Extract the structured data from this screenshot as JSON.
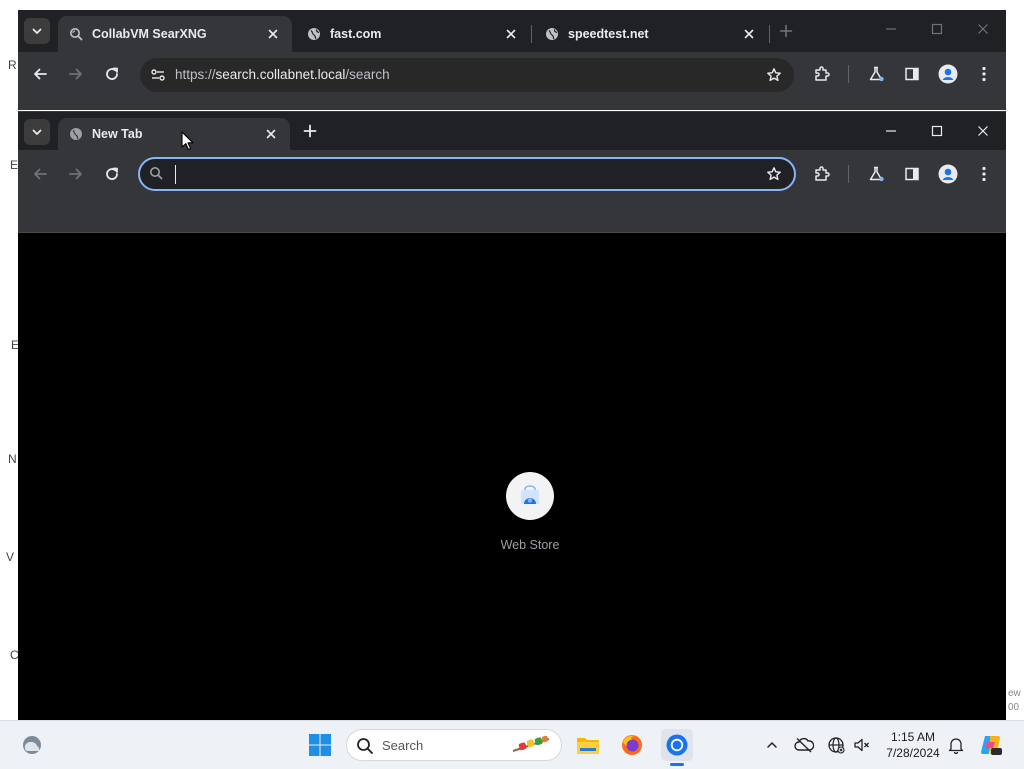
{
  "desktop": {
    "fragments": [
      "R",
      "E",
      "E",
      "N",
      "V",
      "C",
      "ew",
      "00"
    ]
  },
  "back_window": {
    "tabs": [
      {
        "title": "CollabVM SearXNG",
        "favicon": "searxng-icon",
        "active": true
      },
      {
        "title": "fast.com",
        "favicon": "globe-icon",
        "active": false
      },
      {
        "title": "speedtest.net",
        "favicon": "globe-icon",
        "active": false
      }
    ],
    "address": {
      "scheme": "https://",
      "host": "search.collabnet.local",
      "path": "/search"
    }
  },
  "front_window": {
    "tabs": [
      {
        "title": "New Tab",
        "favicon": "new-tab-icon",
        "active": true
      }
    ],
    "address": {
      "value": "",
      "placeholder": ""
    },
    "ntp": {
      "shortcuts": [
        {
          "label": "Web Store",
          "icon": "web-store-icon"
        }
      ]
    }
  },
  "taskbar": {
    "search_label": "Search",
    "clock": {
      "time": "1:15 AM",
      "date": "7/28/2024"
    }
  },
  "colors": {
    "chrome_dark": "#202124",
    "chrome_toolbar": "#35363a",
    "focus_ring": "#8ab4f8",
    "page_bg": "#000000",
    "taskbar_bg": "#eef1f6",
    "accent_blue": "#1a73e8"
  }
}
